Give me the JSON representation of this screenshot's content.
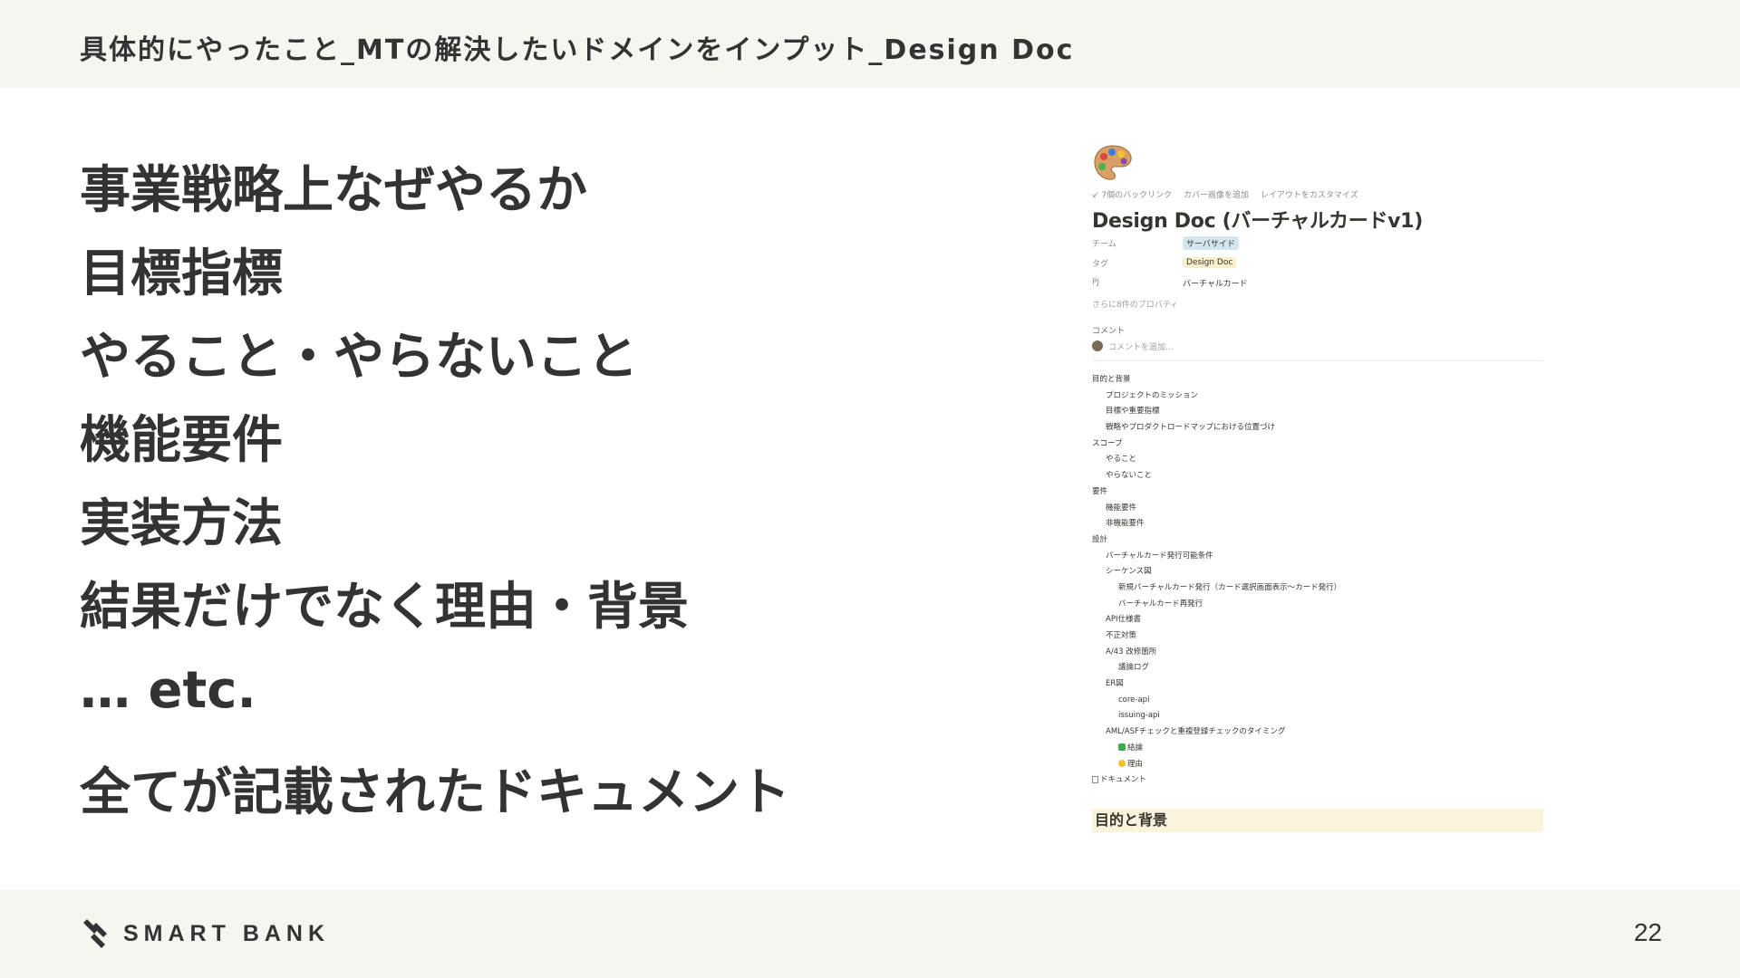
{
  "header": {
    "title": "具体的にやったこと_MTの解決したいドメインをインプット_Design Doc"
  },
  "content": {
    "items": [
      "事業戦略上なぜやるか",
      "目標指標",
      "やること・やらないこと",
      "機能要件",
      "実装方法",
      "結果だけでなく理由・背景",
      "… etc."
    ],
    "summary": "全てが記載されたドキュメント"
  },
  "doc": {
    "emoji_icon": "palette-icon",
    "toolbar": [
      "↙ 7個のバックリンク",
      "カバー画像を追加",
      "レイアウトをカスタマイズ"
    ],
    "title": "Design Doc (バーチャルカードv1)",
    "properties": [
      {
        "key": "チーム",
        "value": "サーバサイド",
        "color": "#d3e5ef"
      },
      {
        "key": "タグ",
        "value": "Design Doc",
        "color": "#fbeecb"
      },
      {
        "key": "PJ",
        "value": "バーチャルカード"
      }
    ],
    "more_properties": "さらに8件のプロパティ",
    "comment_label": "コメント",
    "comment_placeholder": "コメントを追加...",
    "toc": [
      {
        "level": 1,
        "text": "目的と背景"
      },
      {
        "level": 2,
        "text": "プロジェクトのミッション"
      },
      {
        "level": 2,
        "text": "目標や重要指標"
      },
      {
        "level": 2,
        "text": "戦略やプロダクトロードマップにおける位置づけ"
      },
      {
        "level": 1,
        "text": "スコープ"
      },
      {
        "level": 2,
        "text": "やること"
      },
      {
        "level": 2,
        "text": "やらないこと"
      },
      {
        "level": 1,
        "text": "要件"
      },
      {
        "level": 2,
        "text": "機能要件"
      },
      {
        "level": 2,
        "text": "非機能要件"
      },
      {
        "level": 1,
        "text": "設計"
      },
      {
        "level": 2,
        "text": "バーチャルカード発行可能条件"
      },
      {
        "level": 2,
        "text": "シーケンス図"
      },
      {
        "level": 3,
        "text": "新規バーチャルカード発行（カード選択画面表示〜カード発行）"
      },
      {
        "level": 3,
        "text": "バーチャルカード再発行"
      },
      {
        "level": 2,
        "text": "API仕様書"
      },
      {
        "level": 2,
        "text": "不正対策"
      },
      {
        "level": 2,
        "text": "A/43 改修箇所"
      },
      {
        "level": 3,
        "text": "議論ログ"
      },
      {
        "level": 2,
        "text": "ER図"
      },
      {
        "level": 3,
        "text": "core-api"
      },
      {
        "level": 3,
        "text": "issuing-api"
      },
      {
        "level": 2,
        "text": "AML/ASFチェックと重複登録チェックのタイミング"
      },
      {
        "level": 3,
        "text": "結論",
        "icon": "check-icon"
      },
      {
        "level": 3,
        "text": "理由",
        "icon": "smile-icon"
      },
      {
        "level": 1,
        "text": "ドキュメント",
        "icon": "document-icon"
      }
    ],
    "section_heading": "目的と背景"
  },
  "footer": {
    "logo_text": "SMART BANK",
    "page_number": "22"
  }
}
